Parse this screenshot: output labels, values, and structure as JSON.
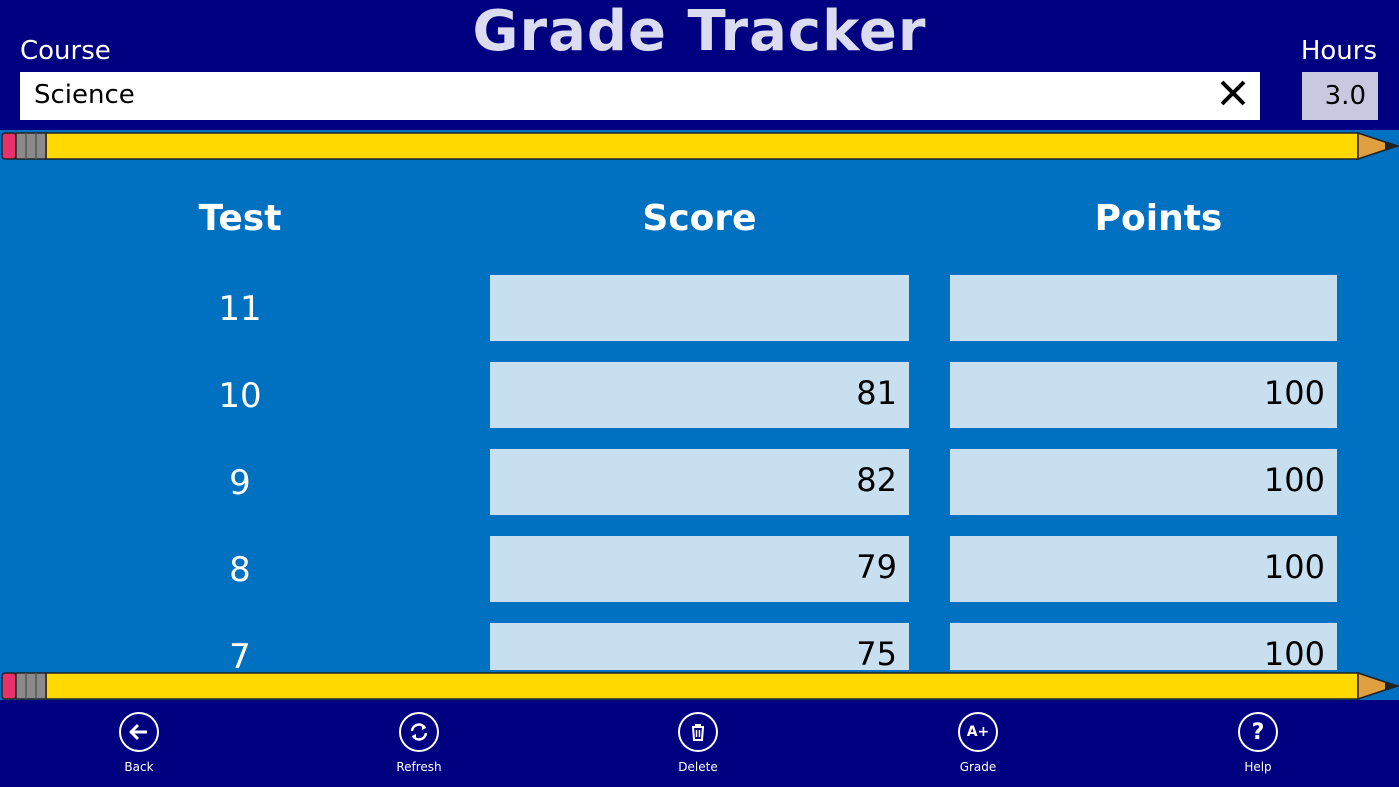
{
  "header": {
    "title": "Grade Tracker",
    "course_label": "Course",
    "course_value": "Science",
    "hours_label": "Hours",
    "hours_value": "3.0"
  },
  "table": {
    "columns": [
      "Test",
      "Score",
      "Points"
    ],
    "rows": [
      {
        "test": "11",
        "score": "",
        "points": ""
      },
      {
        "test": "10",
        "score": "81",
        "points": "100"
      },
      {
        "test": "9",
        "score": "82",
        "points": "100"
      },
      {
        "test": "8",
        "score": "79",
        "points": "100"
      },
      {
        "test": "7",
        "score": "75",
        "points": "100"
      }
    ]
  },
  "nav": {
    "back": "Back",
    "refresh": "Refresh",
    "delete": "Delete",
    "grade": "Grade",
    "help": "Help",
    "grade_icon_text": "A+",
    "help_icon_text": "?"
  },
  "colors": {
    "header_bg": "#000080",
    "body_bg": "#0070c0",
    "cell_bg": "#c8dff0",
    "pencil_yellow": "#ffd800",
    "eraser": "#e8306a"
  }
}
